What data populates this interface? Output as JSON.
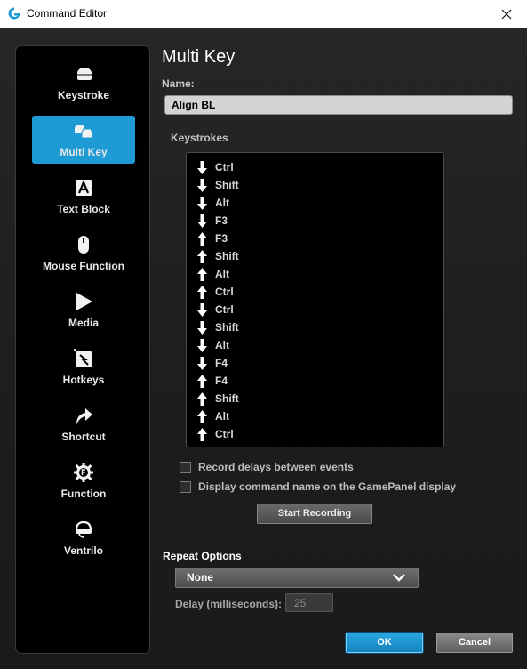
{
  "window": {
    "title": "Command Editor"
  },
  "sidebar": {
    "items": [
      {
        "label": "Keystroke",
        "icon": "keycap-icon",
        "active": false
      },
      {
        "label": "Multi Key",
        "icon": "multi-keycap-icon",
        "active": true
      },
      {
        "label": "Text Block",
        "icon": "text-block-icon",
        "active": false
      },
      {
        "label": "Mouse Function",
        "icon": "mouse-icon",
        "active": false
      },
      {
        "label": "Media",
        "icon": "play-icon",
        "active": false
      },
      {
        "label": "Hotkeys",
        "icon": "hotkeys-icon",
        "active": false
      },
      {
        "label": "Shortcut",
        "icon": "shortcut-arrow-icon",
        "active": false
      },
      {
        "label": "Function",
        "icon": "function-gear-icon",
        "active": false
      },
      {
        "label": "Ventrilo",
        "icon": "headset-icon",
        "active": false
      }
    ]
  },
  "main": {
    "heading": "Multi Key",
    "name_label": "Name:",
    "name_value": "Align BL",
    "keystrokes_label": "Keystrokes",
    "keystrokes": [
      {
        "dir": "down",
        "key": "Ctrl"
      },
      {
        "dir": "down",
        "key": "Shift"
      },
      {
        "dir": "down",
        "key": "Alt"
      },
      {
        "dir": "down",
        "key": "F3"
      },
      {
        "dir": "up",
        "key": "F3"
      },
      {
        "dir": "up",
        "key": "Shift"
      },
      {
        "dir": "up",
        "key": "Alt"
      },
      {
        "dir": "up",
        "key": "Ctrl"
      },
      {
        "dir": "down",
        "key": "Ctrl"
      },
      {
        "dir": "down",
        "key": "Shift"
      },
      {
        "dir": "down",
        "key": "Alt"
      },
      {
        "dir": "down",
        "key": "F4"
      },
      {
        "dir": "up",
        "key": "F4"
      },
      {
        "dir": "up",
        "key": "Shift"
      },
      {
        "dir": "up",
        "key": "Alt"
      },
      {
        "dir": "up",
        "key": "Ctrl"
      }
    ],
    "record_delays_label": "Record delays between events",
    "record_delays_checked": false,
    "display_name_label": "Display command name on the GamePanel display",
    "display_name_checked": false,
    "start_recording_label": "Start Recording",
    "repeat_options_label": "Repeat Options",
    "repeat_value": "None",
    "delay_label": "Delay (milliseconds):",
    "delay_value": "25",
    "ok_label": "OK",
    "cancel_label": "Cancel"
  },
  "colors": {
    "accent": "#1e9bd5",
    "background": "#1f1f1f",
    "sidebar": "#000000",
    "logo": "#1e9bd5"
  }
}
